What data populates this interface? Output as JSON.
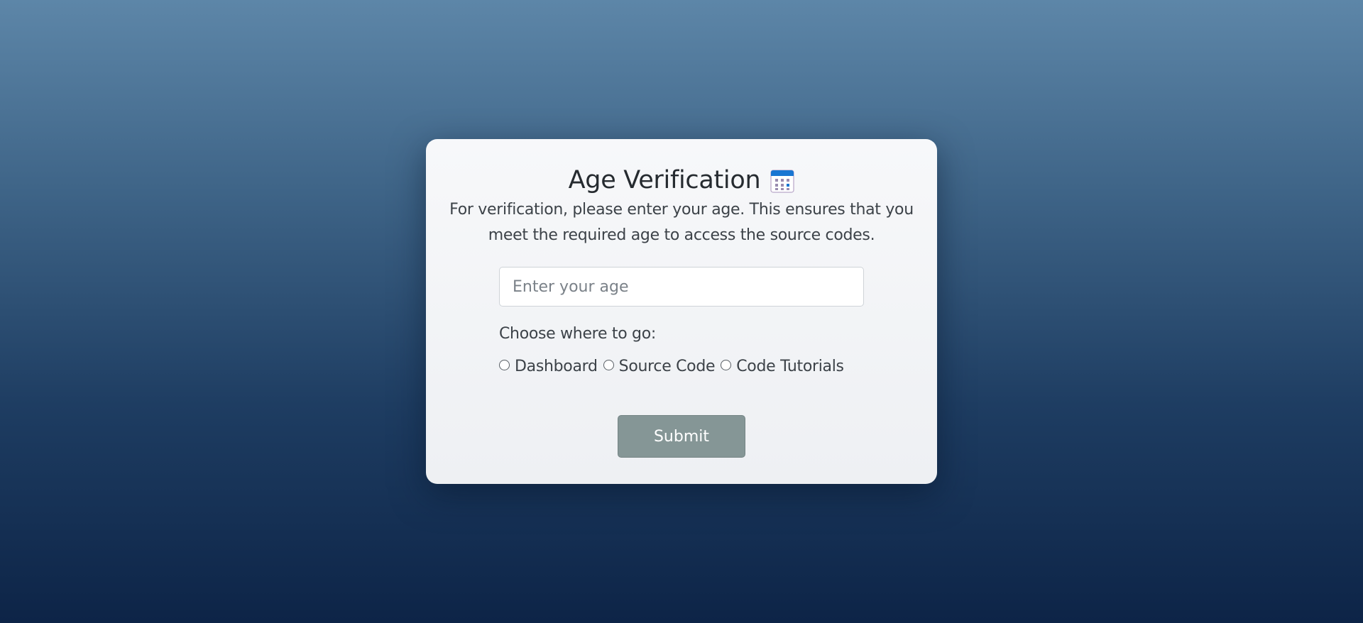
{
  "card": {
    "title": "Age Verification",
    "title_icon": "calendar-icon",
    "description": "For verification, please enter your age. This ensures that you meet the required age to access the source codes.",
    "age_input": {
      "value": "",
      "placeholder": "Enter your age"
    },
    "destination_label": "Choose where to go:",
    "destinations": [
      {
        "label": "Dashboard",
        "selected": false
      },
      {
        "label": "Source Code",
        "selected": false
      },
      {
        "label": "Code Tutorials",
        "selected": false
      }
    ],
    "submit_label": "Submit"
  },
  "colors": {
    "background_top": "#5d86a8",
    "background_bottom": "#0d2447",
    "card_background": "#f3f4f6",
    "submit_button": "#859696",
    "calendar_accent": "#1976d2"
  }
}
